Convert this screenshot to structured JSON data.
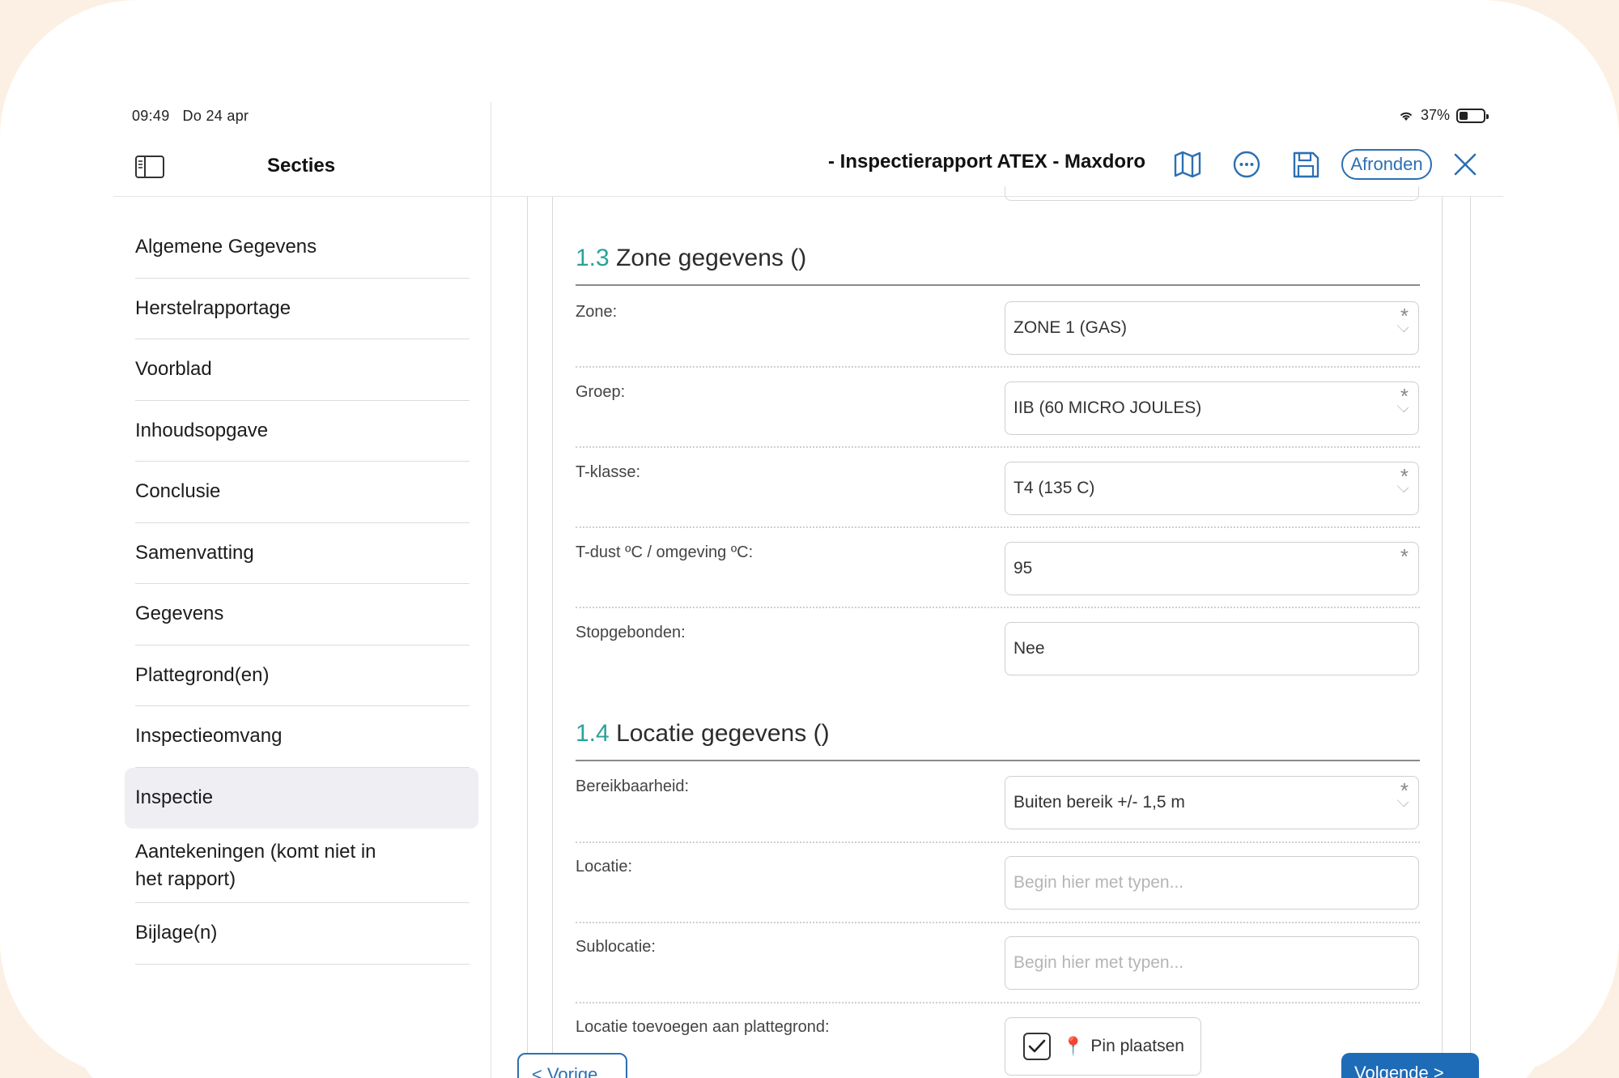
{
  "status_bar": {
    "time": "09:49",
    "date": "Do 24 apr",
    "battery": "37%",
    "battery_level": 0.37
  },
  "sidebar": {
    "title": "Secties",
    "items": [
      {
        "label": "Algemene Gegevens"
      },
      {
        "label": "Herstelrapportage"
      },
      {
        "label": "Voorblad"
      },
      {
        "label": "Inhoudsopgave"
      },
      {
        "label": "Conclusie"
      },
      {
        "label": "Samenvatting"
      },
      {
        "label": "Gegevens"
      },
      {
        "label": "Plattegrond(en)"
      },
      {
        "label": "Inspectieomvang"
      },
      {
        "label": "Inspectie",
        "active": true
      },
      {
        "label": "Aantekeningen (komt niet in het rapport)"
      },
      {
        "label": "Bijlage(n)"
      }
    ]
  },
  "toolbar": {
    "title": "- Inspectierapport ATEX - Maxdoro",
    "finish_label": "Afronden",
    "icons": [
      "map-icon",
      "more-icon",
      "save-icon",
      "close-icon"
    ]
  },
  "sections": [
    {
      "number": "1.3",
      "title": "Zone gegevens ()",
      "rows": [
        {
          "label": "Zone:",
          "value": "ZONE 1 (GAS)",
          "required": true,
          "dropdown": true
        },
        {
          "label": "Groep:",
          "value": "IIB (60 MICRO JOULES)",
          "required": true,
          "dropdown": true
        },
        {
          "label": "T-klasse:",
          "value": "T4 (135 C)",
          "required": true,
          "dropdown": true
        },
        {
          "label": "T-dust ºC / omgeving ºC:",
          "value": "95",
          "required": true,
          "dropdown": false
        },
        {
          "label": "Stopgebonden:",
          "value": "Nee",
          "required": false,
          "dropdown": false
        }
      ]
    },
    {
      "number": "1.4",
      "title": "Locatie gegevens ()",
      "rows": [
        {
          "label": "Bereikbaarheid:",
          "value": "Buiten bereik +/- 1,5 m",
          "required": true,
          "dropdown": true
        },
        {
          "label": "Locatie:",
          "placeholder": "Begin hier met typen..."
        },
        {
          "label": "Sublocatie:",
          "placeholder": "Begin hier met typen..."
        },
        {
          "label": "Locatie toevoegen aan plattegrond:",
          "checkbox_label": "Pin plaatsen",
          "checked": true
        }
      ]
    }
  ],
  "footer": {
    "prev_label": "< Vorige",
    "next_label": "Volgende >"
  },
  "colors": {
    "accent": "#2c6fb2",
    "section_number": "#2aa39a",
    "background": "#fbf0e3",
    "active_nav": "#eeeef3"
  }
}
